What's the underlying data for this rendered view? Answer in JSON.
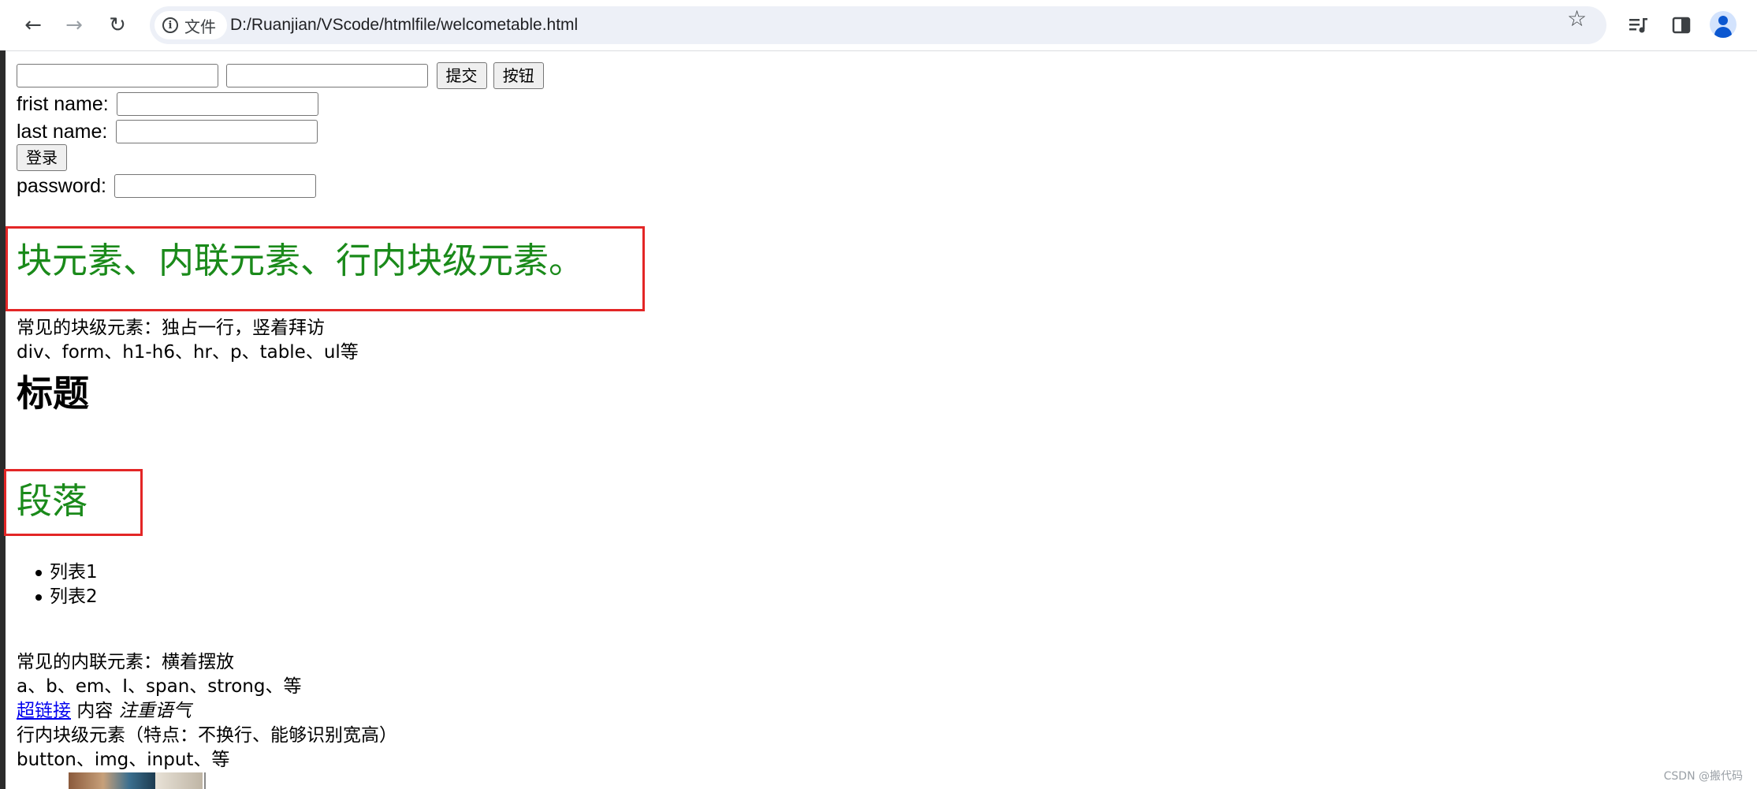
{
  "browser": {
    "site_chip_label": "文件",
    "url": "D:/Ruanjian/VScode/htmlfile/welcometable.html"
  },
  "form": {
    "submit_label": "提交",
    "button_label": "按钮",
    "first_name_label": "frist name:",
    "last_name_label": "last name:",
    "login_label": "登录",
    "password_label": "password:"
  },
  "content": {
    "block_heading": "块元素、内联元素、行内块级元素。",
    "block_desc_1": "常见的块级元素：独占一行，竖着拜访",
    "block_desc_2": "div、form、h1-h6、hr、p、table、ul等",
    "title": "标题",
    "paragraph": "段落",
    "list_items": [
      "列表1",
      "列表2"
    ],
    "inline_desc_1": "常见的内联元素：横着摆放",
    "inline_desc_2": "a、b、em、I、span、strong、等",
    "link_text": "超链接",
    "content_text": "内容",
    "emphasis_text": "注重语气",
    "inline_block_desc_1": "行内块级元素（特点：不换行、能够识别宽高）",
    "inline_block_desc_2": "button、img、input、等"
  },
  "watermark": "CSDN @搬代码",
  "colors": {
    "green_text": "#1a8a1a",
    "red_border": "#e32626",
    "link_blue": "#0000ee"
  }
}
